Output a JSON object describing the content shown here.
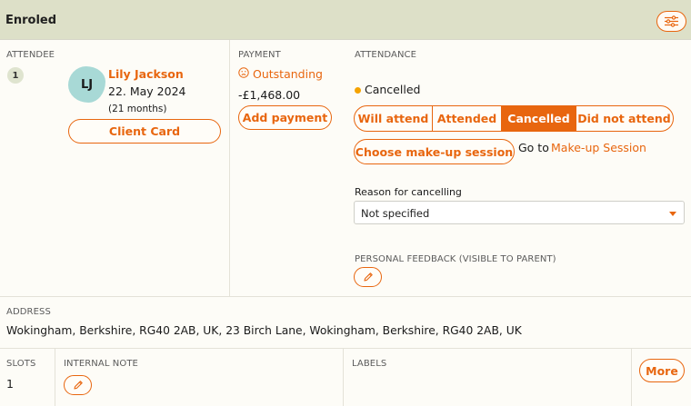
{
  "header": {
    "title": "Enroled",
    "filter_icon": "sliders-icon"
  },
  "attendee": {
    "section_label": "ATTENDEE",
    "index": "1",
    "initials": "LJ",
    "name": "Lily Jackson",
    "dob": "22. May 2024",
    "age": "(21 months)",
    "client_card_label": "Client Card",
    "avatar_color": "#a8d9d6"
  },
  "payment": {
    "section_label": "PAYMENT",
    "status": "Outstanding",
    "status_icon": "sad-face-icon",
    "amount": "-£1,468.00",
    "add_payment_label": "Add payment"
  },
  "attendance": {
    "section_label": "ATTENDANCE",
    "current_status": "Cancelled",
    "status_color": "#f5a300",
    "options": [
      "Will attend",
      "Attended",
      "Cancelled",
      "Did not attend"
    ],
    "selected": "Cancelled",
    "makeup_button_label": "Choose make-up session",
    "goto_prefix": "Go to",
    "goto_link": "Make-up Session",
    "reason_label": "Reason for cancelling",
    "reason_value": "Not specified",
    "feedback_label": "PERSONAL FEEDBACK (VISIBLE TO PARENT)",
    "feedback_icon": "pencil-icon"
  },
  "address": {
    "section_label": "ADDRESS",
    "value": "Wokingham, Berkshire, RG40 2AB, UK, 23 Birch Lane, Wokingham, Berkshire, RG40 2AB, UK"
  },
  "footer": {
    "slots_label": "SLOTS",
    "slots_value": "1",
    "note_label": "INTERNAL NOTE",
    "note_icon": "pencil-icon",
    "labels_label": "LABELS",
    "more_label": "More"
  },
  "accent_color": "#e8660f"
}
